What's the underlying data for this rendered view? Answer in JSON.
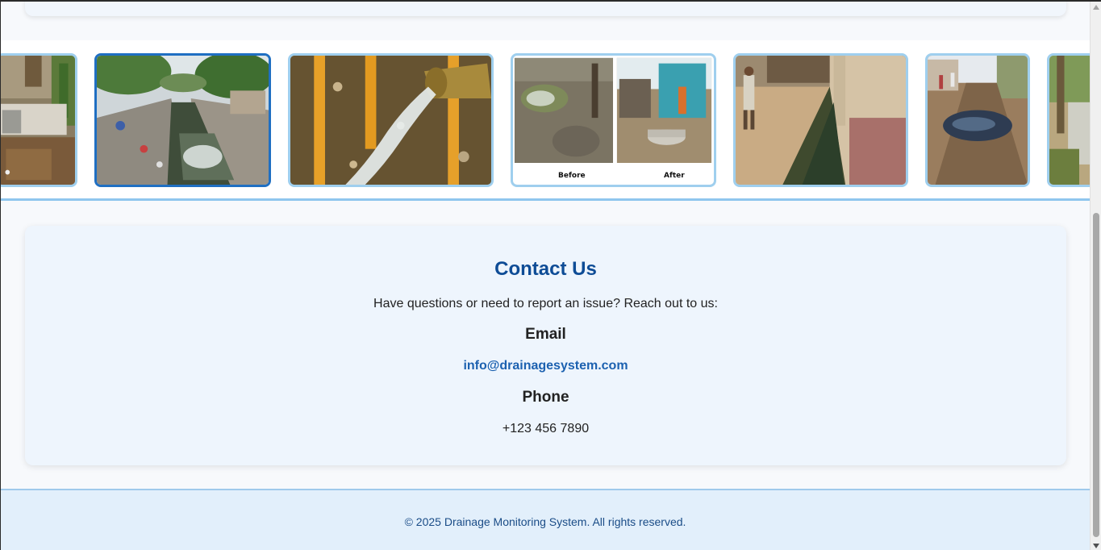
{
  "gallery": {
    "images": [
      {
        "name": "drain-concrete-channel-image"
      },
      {
        "name": "polluted-canal-image"
      },
      {
        "name": "water-pipe-outflow-image"
      },
      {
        "name": "before-after-drain-image",
        "before_label": "Before",
        "after_label": "After"
      },
      {
        "name": "street-drain-village-image"
      },
      {
        "name": "waterlogged-street-image"
      },
      {
        "name": "roadside-drain-image"
      }
    ]
  },
  "contact": {
    "title": "Contact Us",
    "intro": "Have questions or need to report an issue? Reach out to us:",
    "email_heading": "Email",
    "email_value": "info@drainagesystem.com",
    "phone_heading": "Phone",
    "phone_value": "+123 456 7890"
  },
  "footer": {
    "copyright": "© 2025 Drainage Monitoring System. All rights reserved."
  },
  "colors": {
    "accent": "#0e4c96",
    "link": "#1c61b0",
    "thumb_border": "#9fcfee",
    "thumb_active_border": "#1f6fc2",
    "footer_bg": "#e2effb"
  }
}
